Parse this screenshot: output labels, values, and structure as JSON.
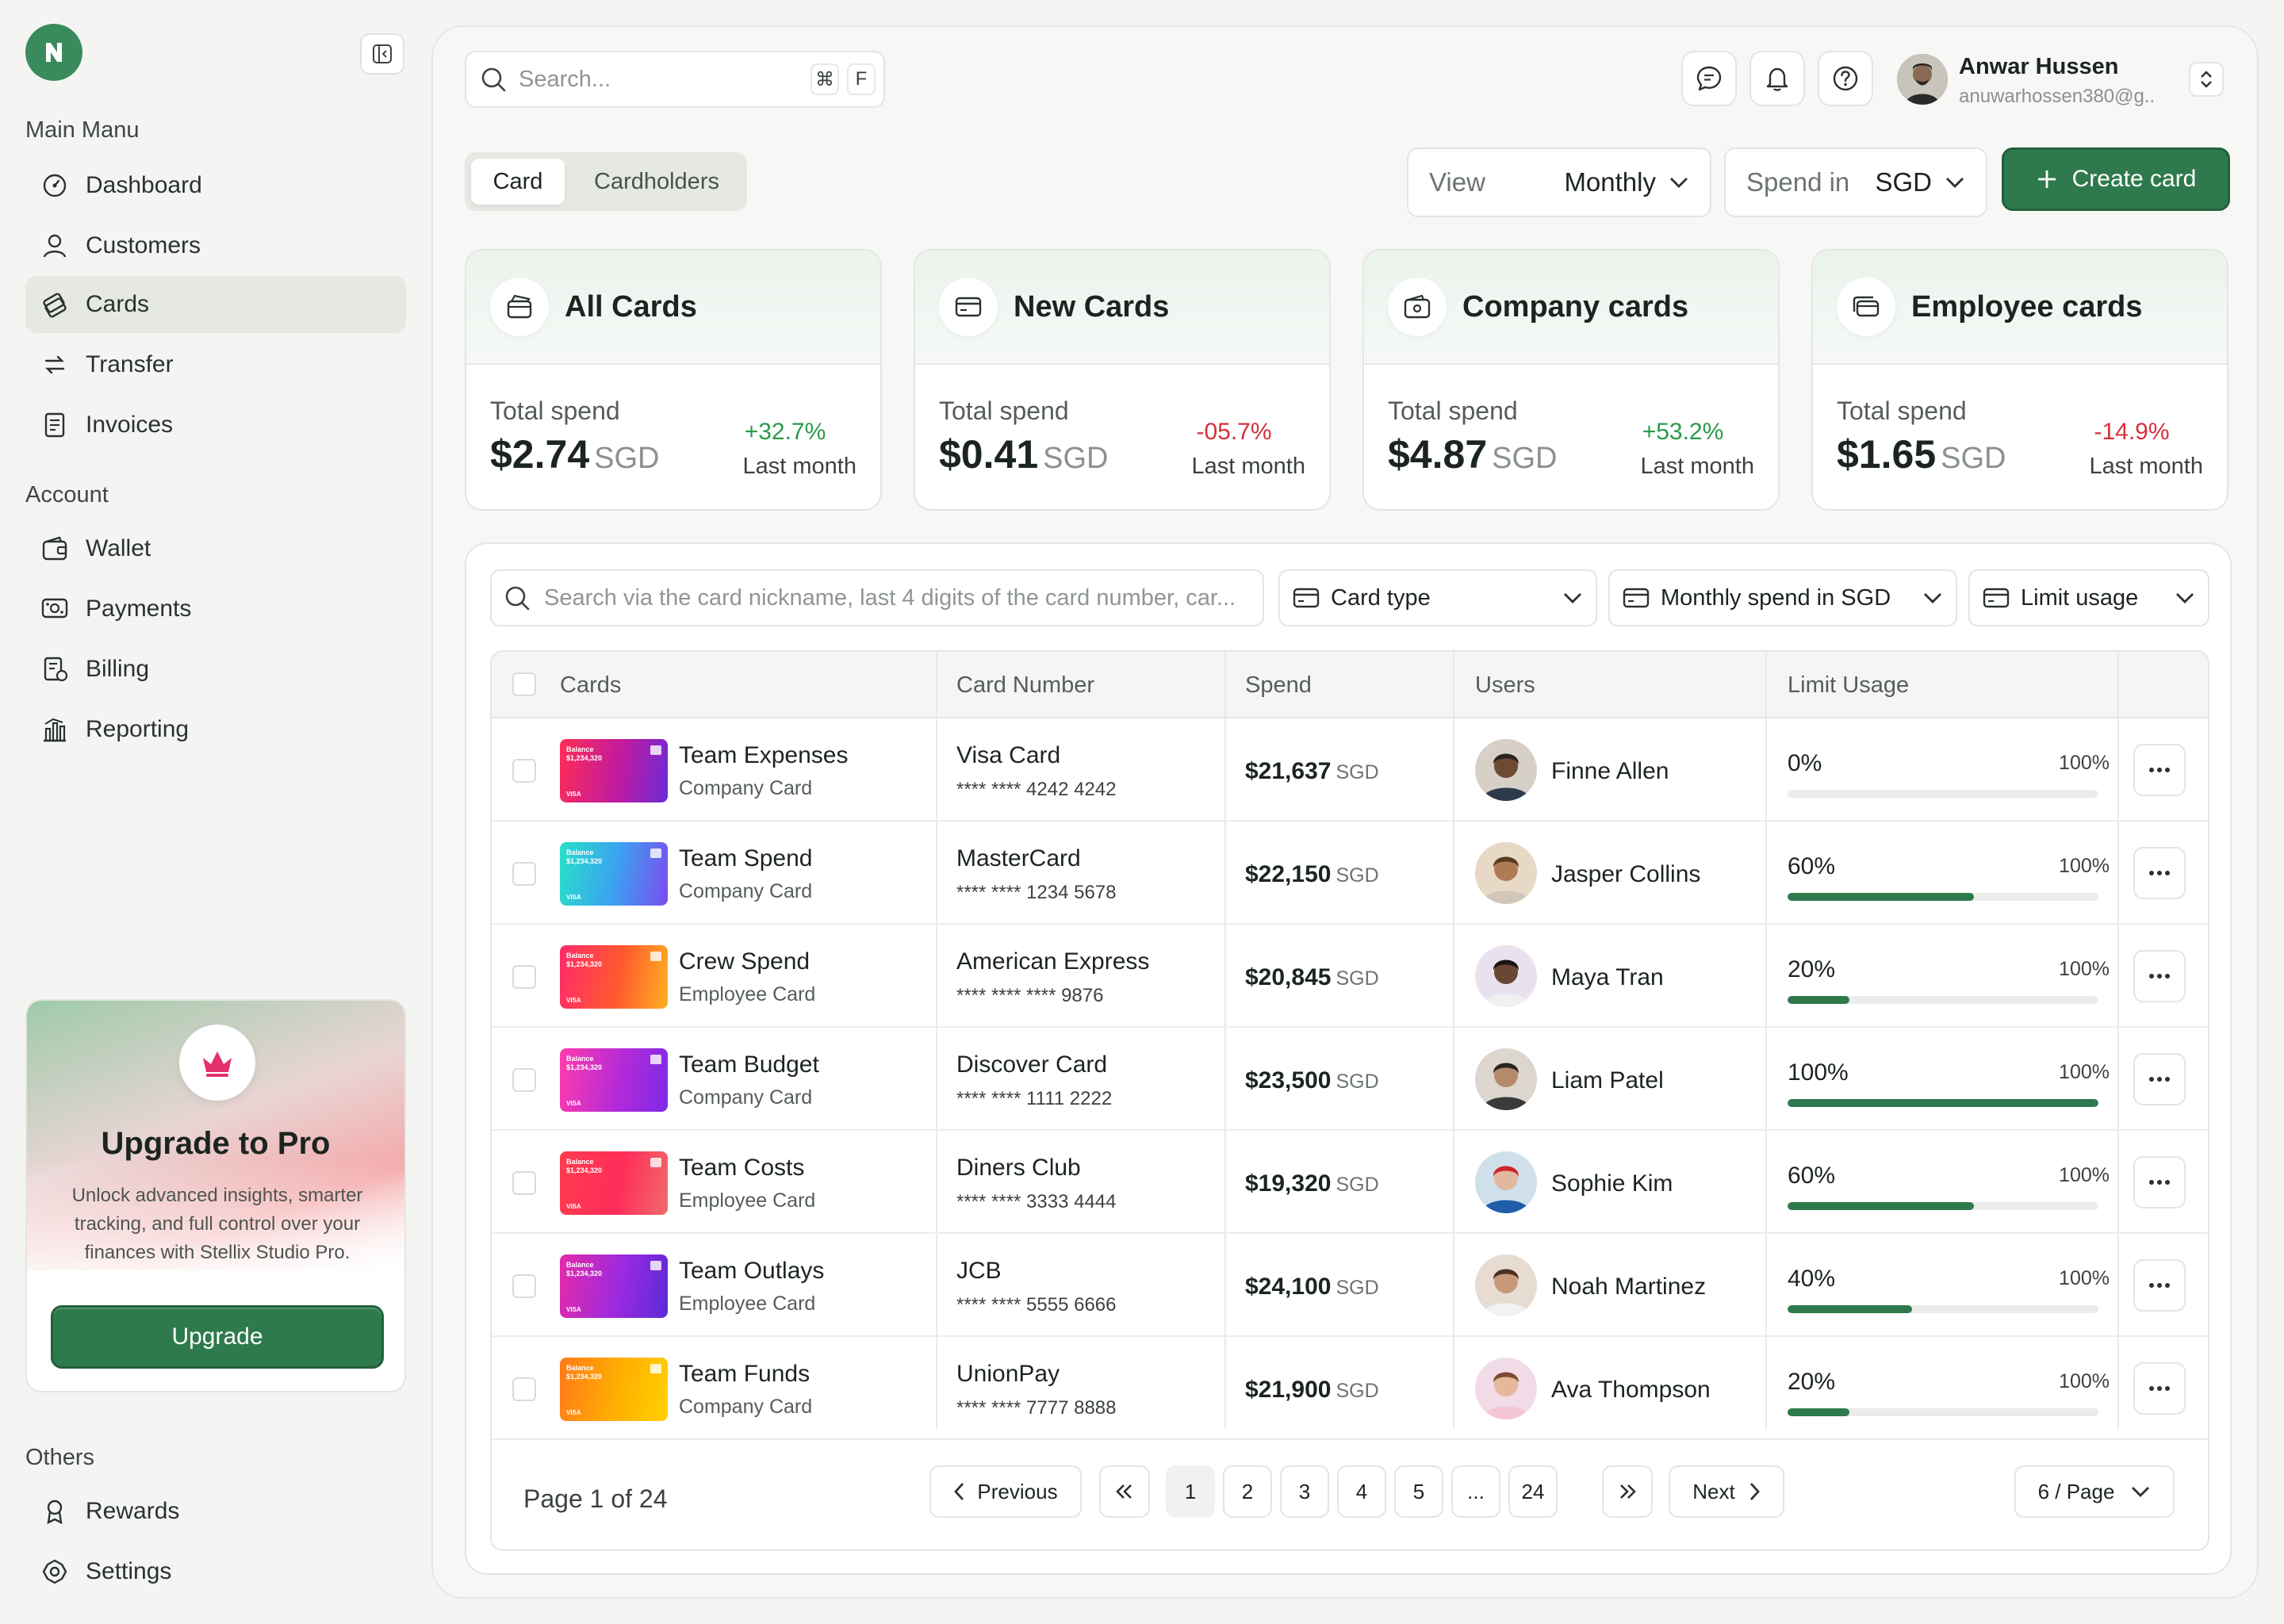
{
  "sidebar": {
    "main_menu_label": "Main Manu",
    "account_label": "Account",
    "others_label": "Others",
    "main_items": [
      {
        "label": "Dashboard",
        "icon": "gauge-icon"
      },
      {
        "label": "Customers",
        "icon": "user-icon"
      },
      {
        "label": "Cards",
        "icon": "cards-icon",
        "active": true
      },
      {
        "label": "Transfer",
        "icon": "transfer-icon"
      },
      {
        "label": "Invoices",
        "icon": "invoice-icon"
      }
    ],
    "account_items": [
      {
        "label": "Wallet",
        "icon": "wallet-icon"
      },
      {
        "label": "Payments",
        "icon": "payments-icon"
      },
      {
        "label": "Billing",
        "icon": "billing-icon"
      },
      {
        "label": "Reporting",
        "icon": "reporting-icon"
      }
    ],
    "other_items": [
      {
        "label": "Rewards",
        "icon": "rewards-icon"
      },
      {
        "label": "Settings",
        "icon": "settings-icon"
      }
    ],
    "upgrade": {
      "title": "Upgrade to Pro",
      "description": "Unlock advanced insights, smarter tracking, and full control over your finances with Stellix Studio Pro.",
      "button": "Upgrade"
    }
  },
  "header": {
    "search_placeholder": "Search...",
    "shortcut_cmd": "⌘",
    "shortcut_key": "F",
    "user_name": "Anwar Hussen",
    "user_email": "anuwarhossen380@g.."
  },
  "toolbar": {
    "tabs": [
      "Card",
      "Cardholders"
    ],
    "active_tab": "Card",
    "view_label": "View",
    "view_value": "Monthly",
    "spend_label": "Spend in",
    "spend_value": "SGD",
    "create_label": "Create card"
  },
  "stats": [
    {
      "title": "All Cards",
      "label": "Total spend",
      "amount": "$2.74",
      "currency": "SGD",
      "change": "+32.7%",
      "direction": "up",
      "period": "Last month"
    },
    {
      "title": "New Cards",
      "label": "Total spend",
      "amount": "$0.41",
      "currency": "SGD",
      "change": "-05.7%",
      "direction": "down",
      "period": "Last month"
    },
    {
      "title": "Company cards",
      "label": "Total spend",
      "amount": "$4.87",
      "currency": "SGD",
      "change": "+53.2%",
      "direction": "up",
      "period": "Last month"
    },
    {
      "title": "Employee cards",
      "label": "Total spend",
      "amount": "$1.65",
      "currency": "SGD",
      "change": "-14.9%",
      "direction": "down",
      "period": "Last month"
    }
  ],
  "filters": {
    "search_placeholder": "Search via the card nickname, last 4 digits of the card number, car...",
    "card_type": "Card type",
    "monthly_spend": "Monthly spend in SGD",
    "limit_usage": "Limit usage"
  },
  "table": {
    "headers": [
      "Cards",
      "Card Number",
      "Spend",
      "Users",
      "Limit Usage"
    ],
    "card_balance_label": "Balance",
    "card_balance_value": "$1,234,320",
    "card_brand": "VISA",
    "rows": [
      {
        "card": "Team Expenses",
        "type": "Company Card",
        "network": "Visa Card",
        "number": "**** **** 4242 4242",
        "spend": "$21,637",
        "currency": "SGD",
        "user": "Finne Allen",
        "usage": "0%",
        "usage_value": 0,
        "limit": "100%"
      },
      {
        "card": "Team Spend",
        "type": "Company Card",
        "network": "MasterCard",
        "number": "**** **** 1234 5678",
        "spend": "$22,150",
        "currency": "SGD",
        "user": "Jasper Collins",
        "usage": "60%",
        "usage_value": 60,
        "limit": "100%"
      },
      {
        "card": "Crew Spend",
        "type": "Employee Card",
        "network": "American Express",
        "number": "**** **** **** 9876",
        "spend": "$20,845",
        "currency": "SGD",
        "user": "Maya Tran",
        "usage": "20%",
        "usage_value": 20,
        "limit": "100%"
      },
      {
        "card": "Team Budget",
        "type": "Company Card",
        "network": "Discover Card",
        "number": "**** **** 1111 2222",
        "spend": "$23,500",
        "currency": "SGD",
        "user": "Liam Patel",
        "usage": "100%",
        "usage_value": 100,
        "limit": "100%"
      },
      {
        "card": "Team Costs",
        "type": "Employee Card",
        "network": "Diners Club",
        "number": "**** **** 3333 4444",
        "spend": "$19,320",
        "currency": "SGD",
        "user": "Sophie Kim",
        "usage": "60%",
        "usage_value": 60,
        "limit": "100%"
      },
      {
        "card": "Team Outlays",
        "type": "Employee Card",
        "network": "JCB",
        "number": "**** **** 5555 6666",
        "spend": "$24,100",
        "currency": "SGD",
        "user": "Noah Martinez",
        "usage": "40%",
        "usage_value": 40,
        "limit": "100%"
      },
      {
        "card": "Team Funds",
        "type": "Company Card",
        "network": "UnionPay",
        "number": "**** **** 7777 8888",
        "spend": "$21,900",
        "currency": "SGD",
        "user": "Ava Thompson",
        "usage": "20%",
        "usage_value": 20,
        "limit": "100%"
      }
    ]
  },
  "pagination": {
    "label": "Page 1 of 24",
    "previous": "Previous",
    "next": "Next",
    "first": "«",
    "last": "»",
    "pages": [
      "1",
      "2",
      "3",
      "4",
      "5",
      "...",
      "24"
    ],
    "current": "1",
    "per_page": "6 / Page"
  },
  "colors": {
    "accent": "#2f7a4c",
    "up": "#2a9a4a",
    "down": "#d6303b"
  }
}
